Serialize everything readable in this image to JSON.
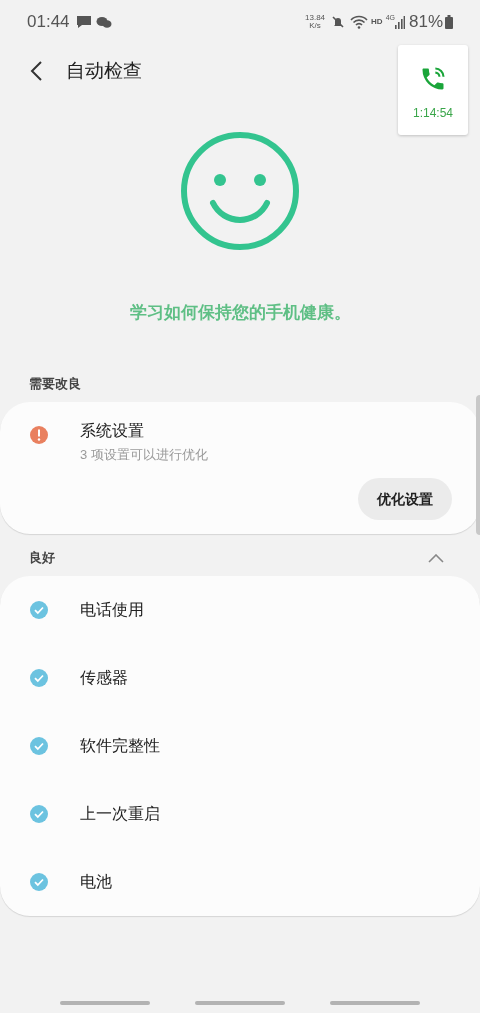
{
  "status_bar": {
    "time": "01:44",
    "net_speed": [
      "13.84",
      "K/s"
    ],
    "hd": "HD",
    "network": "4G",
    "battery": "81%"
  },
  "call_bubble": {
    "duration": "1:14:54"
  },
  "header": {
    "title": "自动检查"
  },
  "message": "学习如何保持您的手机健康。",
  "sections": [
    {
      "title": "需要改良",
      "items": [
        {
          "kind": "warning",
          "title": "系统设置",
          "subtitle": "3 项设置可以进行优化",
          "button": "优化设置"
        }
      ]
    },
    {
      "title": "良好",
      "expanded": true,
      "items": [
        {
          "kind": "ok",
          "title": "电话使用"
        },
        {
          "kind": "ok",
          "title": "传感器"
        },
        {
          "kind": "ok",
          "title": "软件完整性"
        },
        {
          "kind": "ok",
          "title": "上一次重启"
        },
        {
          "kind": "ok",
          "title": "电池"
        }
      ]
    }
  ]
}
